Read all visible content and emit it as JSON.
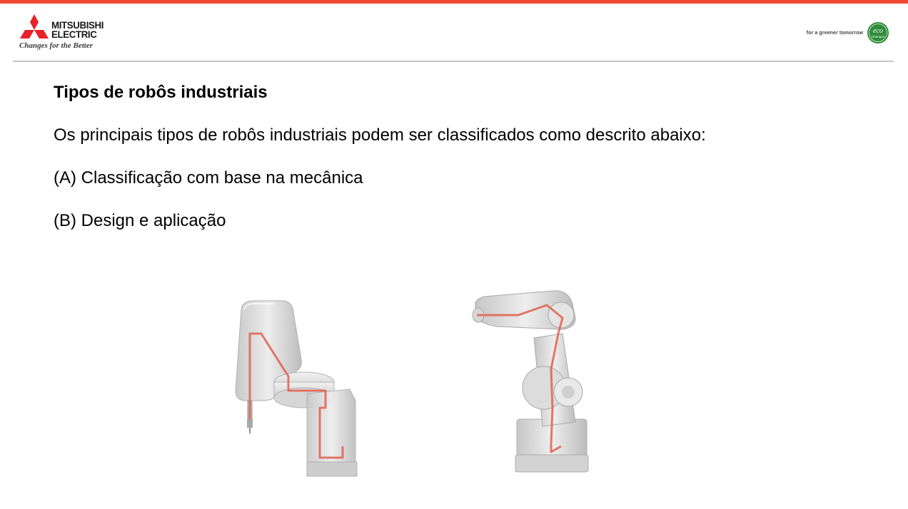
{
  "header": {
    "brand_line1": "MITSUBISHI",
    "brand_line2": "ELECTRIC",
    "brand_tagline": "Changes for the Better",
    "eco_tagline": "for a greener tomorrow",
    "eco_badge_line1": "eco",
    "eco_badge_line2": "Changes",
    "accent_color": "#ef4a34",
    "eco_color": "#2e8b3a"
  },
  "slide": {
    "title": "Tipos de robôs industriais",
    "paragraphs": [
      "Os principais tipos de robôs industriais podem ser classificados como descrito abaixo:",
      "(A) Classificação com base na mecânica",
      "(B) Design e aplicação"
    ]
  },
  "figures": [
    {
      "icon": "scara-robot-illustration"
    },
    {
      "icon": "articulated-robot-illustration"
    }
  ]
}
